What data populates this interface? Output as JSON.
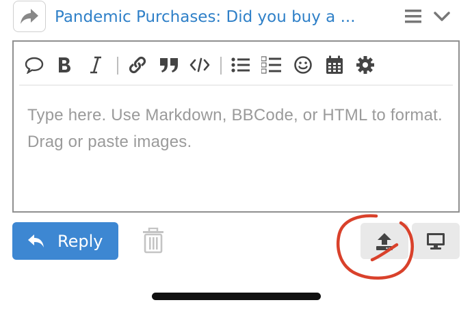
{
  "header": {
    "topic_title": "Pandemic Purchases: Did you buy a ...",
    "reply_icon": "share-arrow-icon",
    "menu_icon": "hamburger-icon",
    "collapse_icon": "chevron-down-icon"
  },
  "toolbar": {
    "items": [
      "quote-icon",
      "bold-icon",
      "italic-icon",
      "link-icon",
      "blockquote-icon",
      "code-icon",
      "bullet-list-icon",
      "numbered-list-icon",
      "emoji-icon",
      "calendar-icon",
      "gear-icon"
    ]
  },
  "editor": {
    "placeholder": "Type here. Use Markdown, BBCode, or HTML to format. Drag or paste images."
  },
  "footer": {
    "reply_label": "Reply",
    "trash_icon": "trash-icon",
    "upload_icon": "upload-icon",
    "preview_icon": "monitor-icon"
  },
  "colors": {
    "accent": "#3d87d2",
    "title": "#2f80c8",
    "annotation": "#d9412b"
  }
}
